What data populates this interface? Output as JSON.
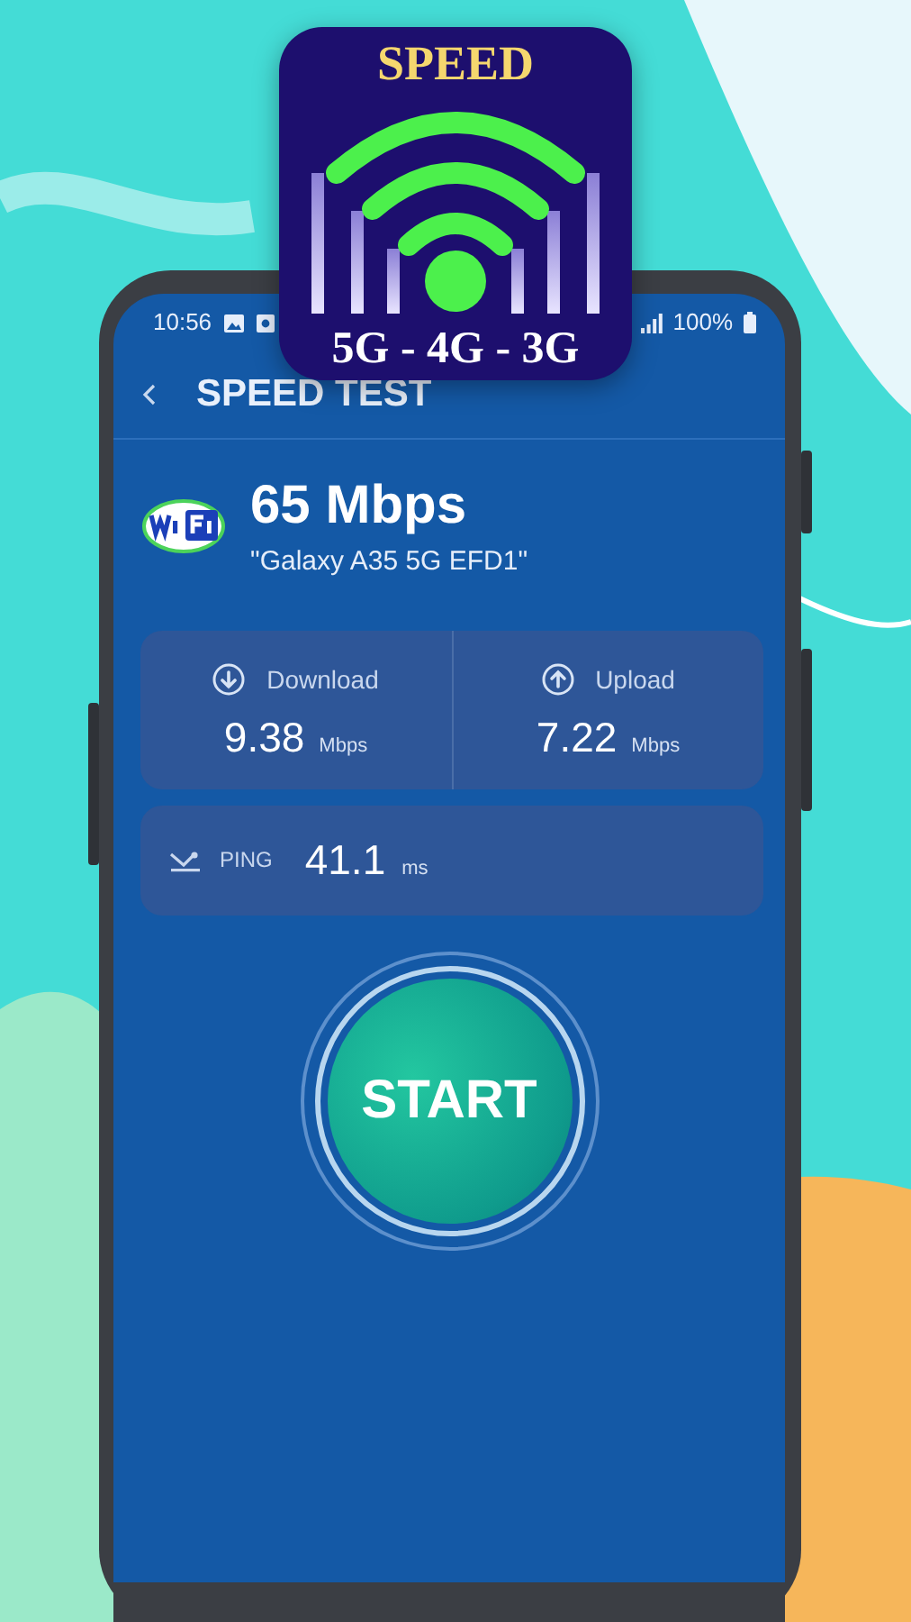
{
  "app_icon": {
    "title": "SPEED",
    "networks": "5G - 4G - 3G"
  },
  "status_bar": {
    "time": "10:56",
    "battery": "100%"
  },
  "toolbar": {
    "title": "SPEED TEST"
  },
  "connection": {
    "speed": "65 Mbps",
    "network": "\"Galaxy A35 5G EFD1\""
  },
  "results": [
    {
      "kind": "download",
      "label": "Download",
      "value": "9.38",
      "unit": "Mbps"
    },
    {
      "kind": "upload",
      "label": "Upload",
      "value": "7.22",
      "unit": "Mbps"
    }
  ],
  "ping": {
    "label": "PING",
    "value": "41.1",
    "unit": "ms"
  },
  "start_button": {
    "label": "START"
  }
}
